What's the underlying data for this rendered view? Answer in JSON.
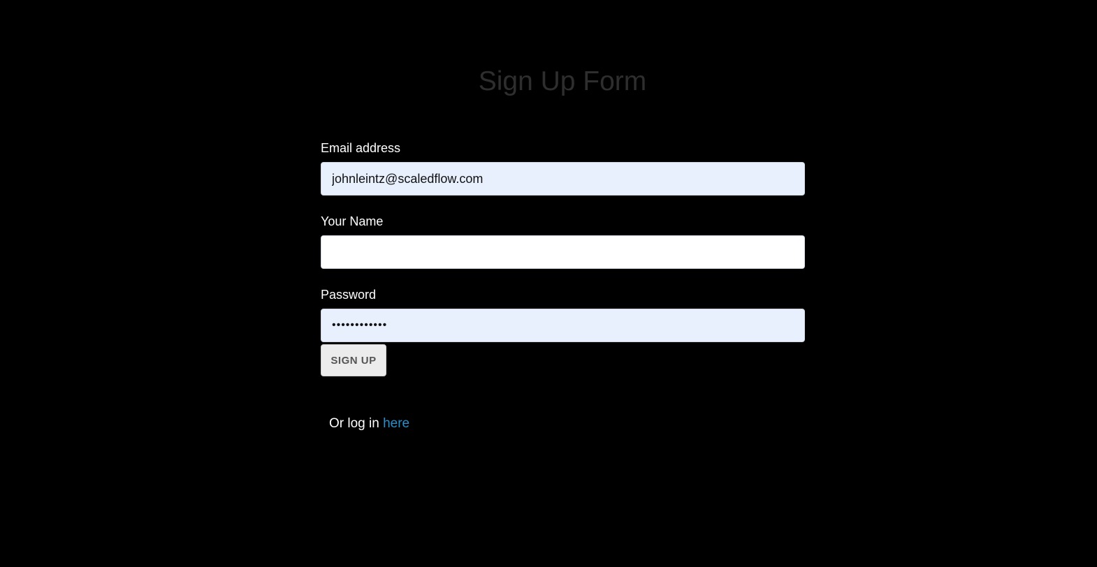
{
  "page": {
    "title": "Sign Up Form"
  },
  "form": {
    "email": {
      "label": "Email address",
      "value": "johnleintz@scaledflow.com"
    },
    "name": {
      "label": "Your Name",
      "value": ""
    },
    "password": {
      "label": "Password",
      "value": "••••••••••••"
    },
    "submit_label": "SIGN UP"
  },
  "login": {
    "prefix": "Or log in",
    "link_text": "here"
  },
  "colors": {
    "background": "#000000",
    "title": "#2e2e2e",
    "autofill_field": "#e8f0fe",
    "link": "#2a8fc8",
    "button": "#ececec"
  }
}
